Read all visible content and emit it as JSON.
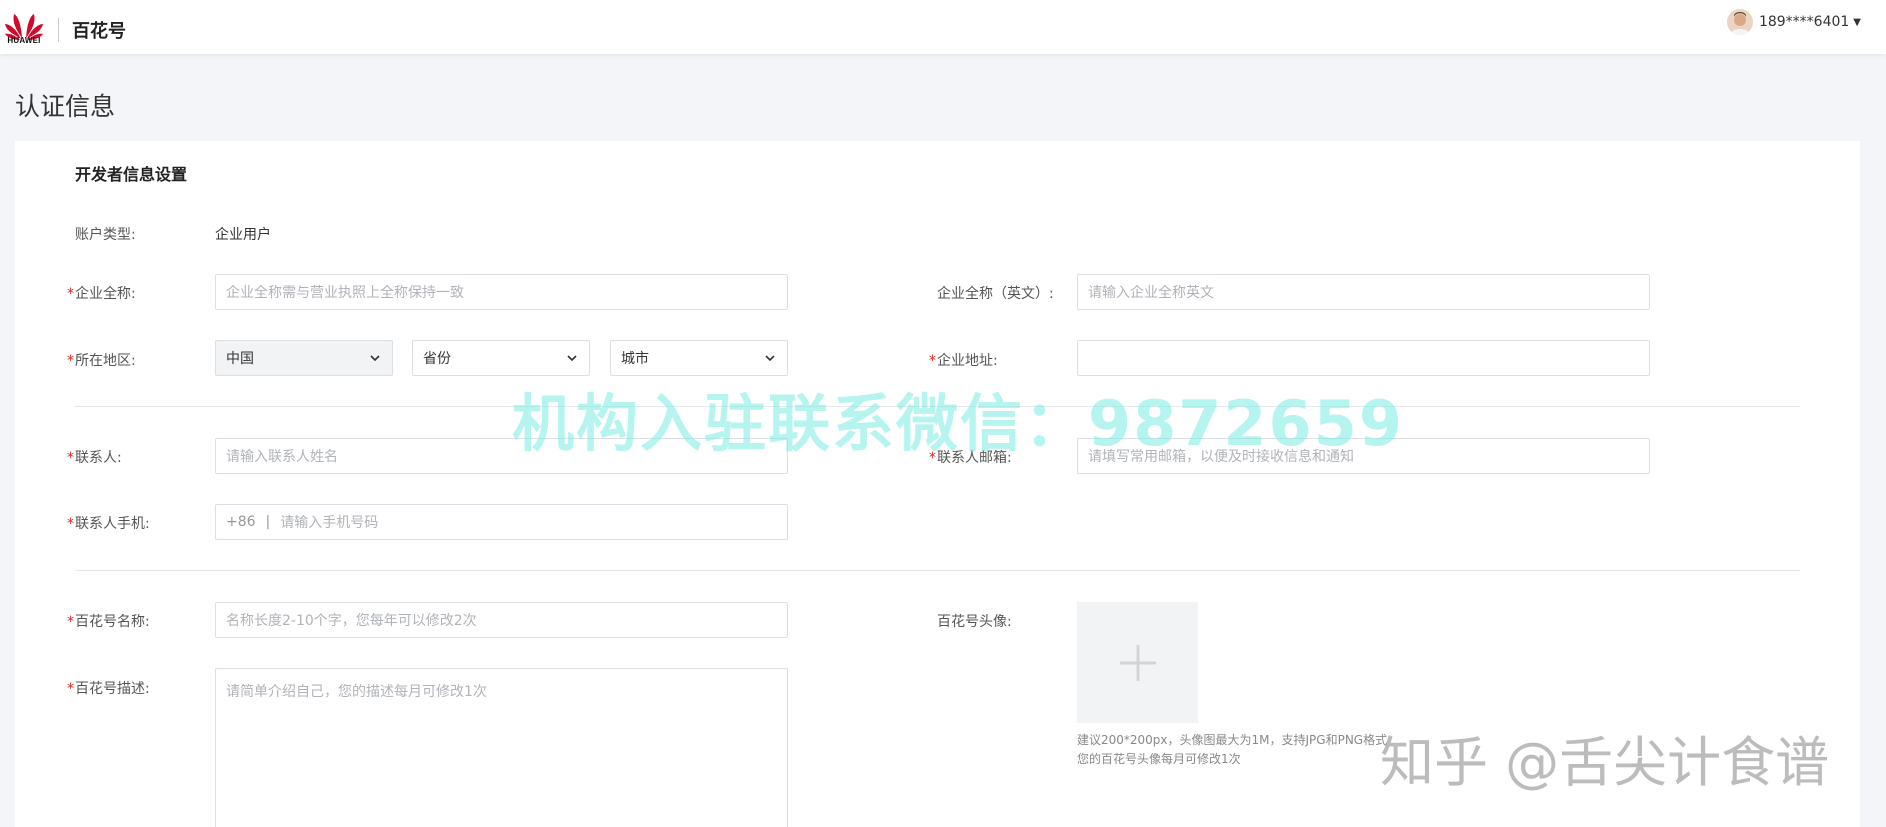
{
  "header": {
    "logo_text": "HUAWEI",
    "app_name": "百花号",
    "user_phone": "189****6401"
  },
  "page": {
    "title": "认证信息"
  },
  "form": {
    "section_title": "开发者信息设置",
    "account_type": {
      "label": "账户类型:",
      "value": "企业用户"
    },
    "company_name": {
      "label": "企业全称:",
      "placeholder": "企业全称需与营业执照上全称保持一致"
    },
    "company_name_en": {
      "label": "企业全称（英文）:",
      "placeholder": "请输入企业全称英文"
    },
    "region": {
      "label": "所在地区:",
      "country": "中国",
      "province": "省份",
      "city": "城市"
    },
    "company_address": {
      "label": "企业地址:",
      "placeholder": ""
    },
    "contact_name": {
      "label": "联系人:",
      "placeholder": "请输入联系人姓名"
    },
    "contact_email": {
      "label": "联系人邮箱:",
      "placeholder": "请填写常用邮箱，以便及时接收信息和通知"
    },
    "contact_phone": {
      "label": "联系人手机:",
      "prefix": "+86",
      "separator": "|",
      "placeholder": "请输入手机号码"
    },
    "account_name": {
      "label": "百花号名称:",
      "placeholder": "名称长度2-10个字，您每年可以修改2次"
    },
    "account_avatar": {
      "label": "百花号头像:",
      "hint_line1": "建议200*200px，头像图最大为1M，支持JPG和PNG格式",
      "hint_line2": "您的百花号头像每月可修改1次"
    },
    "account_desc": {
      "label": "百花号描述:",
      "placeholder": "请简单介绍自己，您的描述每月可修改1次"
    }
  },
  "overlays": {
    "watermark": "机构入驻联系微信：9872659",
    "zhihu": "知乎 @舌尖计食谱"
  },
  "colors": {
    "required": "#e02020",
    "brand_red": "#cf0a2c",
    "watermark": "#78ebe1"
  }
}
